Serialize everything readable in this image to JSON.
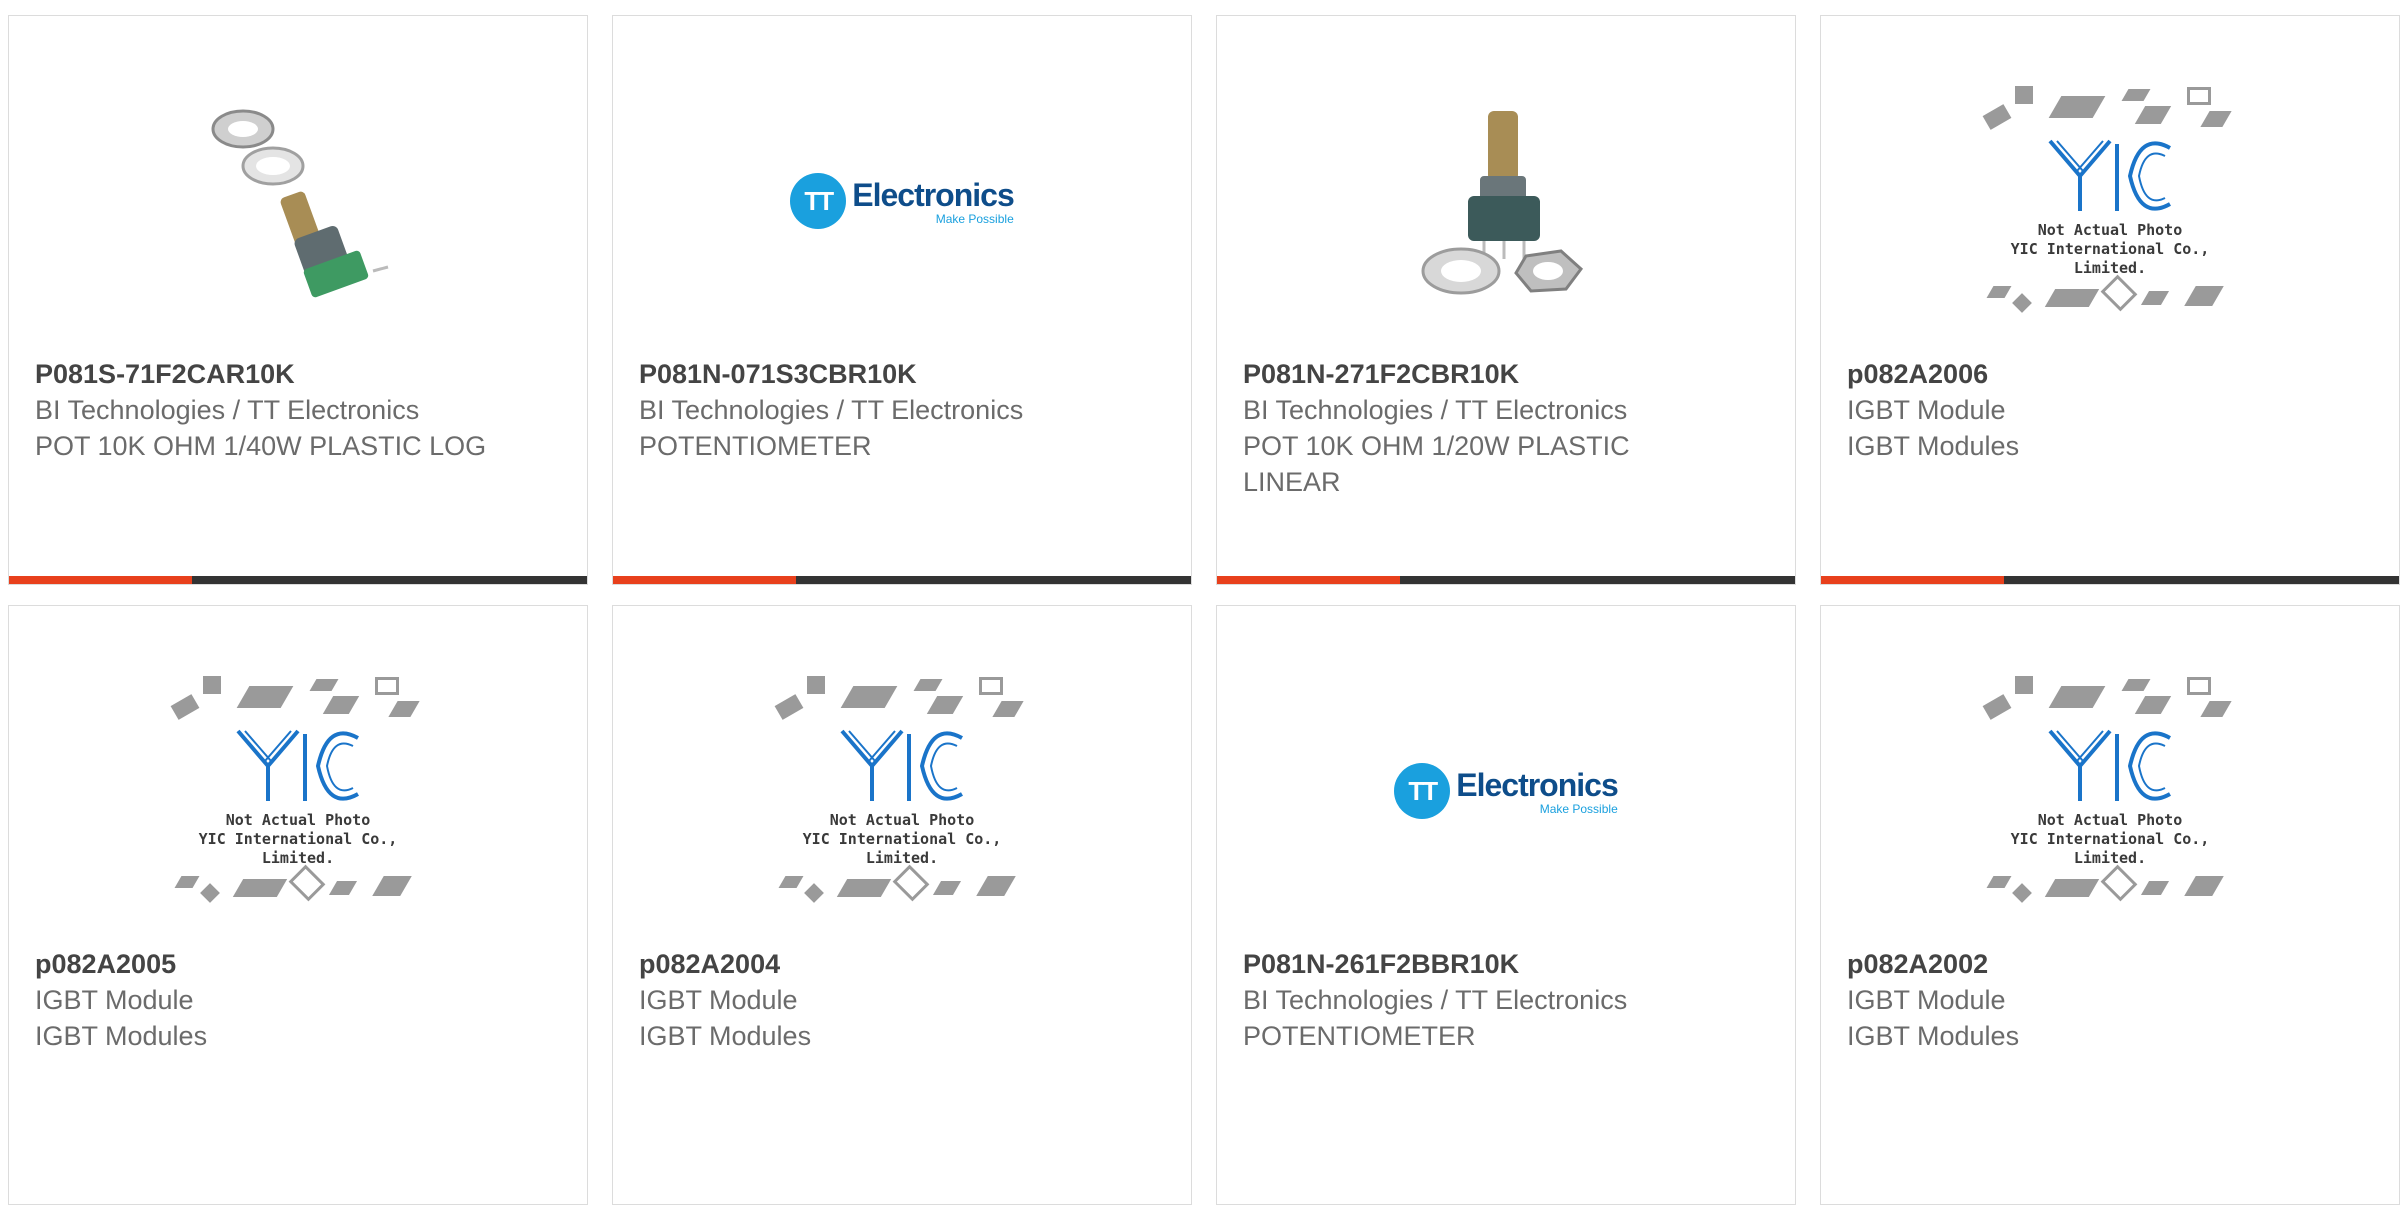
{
  "products": [
    {
      "part": "P081S-71F2CAR10K",
      "mfr": "BI Technologies / TT Electronics",
      "desc": "POT 10K OHM 1/40W PLASTIC LOG",
      "image": "potentiometer-photo"
    },
    {
      "part": "P081N-071S3CBR10K",
      "mfr": "BI Technologies / TT Electronics",
      "desc": "POTENTIOMETER",
      "image": "tt-electronics-logo"
    },
    {
      "part": "P081N-271F2CBR10K",
      "mfr": "BI Technologies / TT Electronics",
      "desc": "POT 10K OHM 1/20W PLASTIC LINEAR",
      "image": "potentiometer-photo"
    },
    {
      "part": "p082A2006",
      "mfr": "IGBT Module",
      "desc": "IGBT Modules",
      "image": "yic-placeholder"
    },
    {
      "part": "p082A2005",
      "mfr": "IGBT Module",
      "desc": "IGBT Modules",
      "image": "yic-placeholder"
    },
    {
      "part": "p082A2004",
      "mfr": "IGBT Module",
      "desc": "IGBT Modules",
      "image": "yic-placeholder"
    },
    {
      "part": "P081N-261F2BBR10K",
      "mfr": "BI Technologies / TT Electronics",
      "desc": "POTENTIOMETER",
      "image": "tt-electronics-logo"
    },
    {
      "part": "p082A2002",
      "mfr": "IGBT Module",
      "desc": "IGBT Modules",
      "image": "yic-placeholder"
    }
  ],
  "logos": {
    "tt_mark": "TT",
    "tt_word": "Electronics",
    "tt_tagline": "Make Possible",
    "yic_caption_1": "Not Actual Photo",
    "yic_caption_2": "YIC International Co., Limited."
  },
  "colors": {
    "accent": "#e8401c",
    "bar": "#333333",
    "tt_blue": "#1aa0de"
  }
}
